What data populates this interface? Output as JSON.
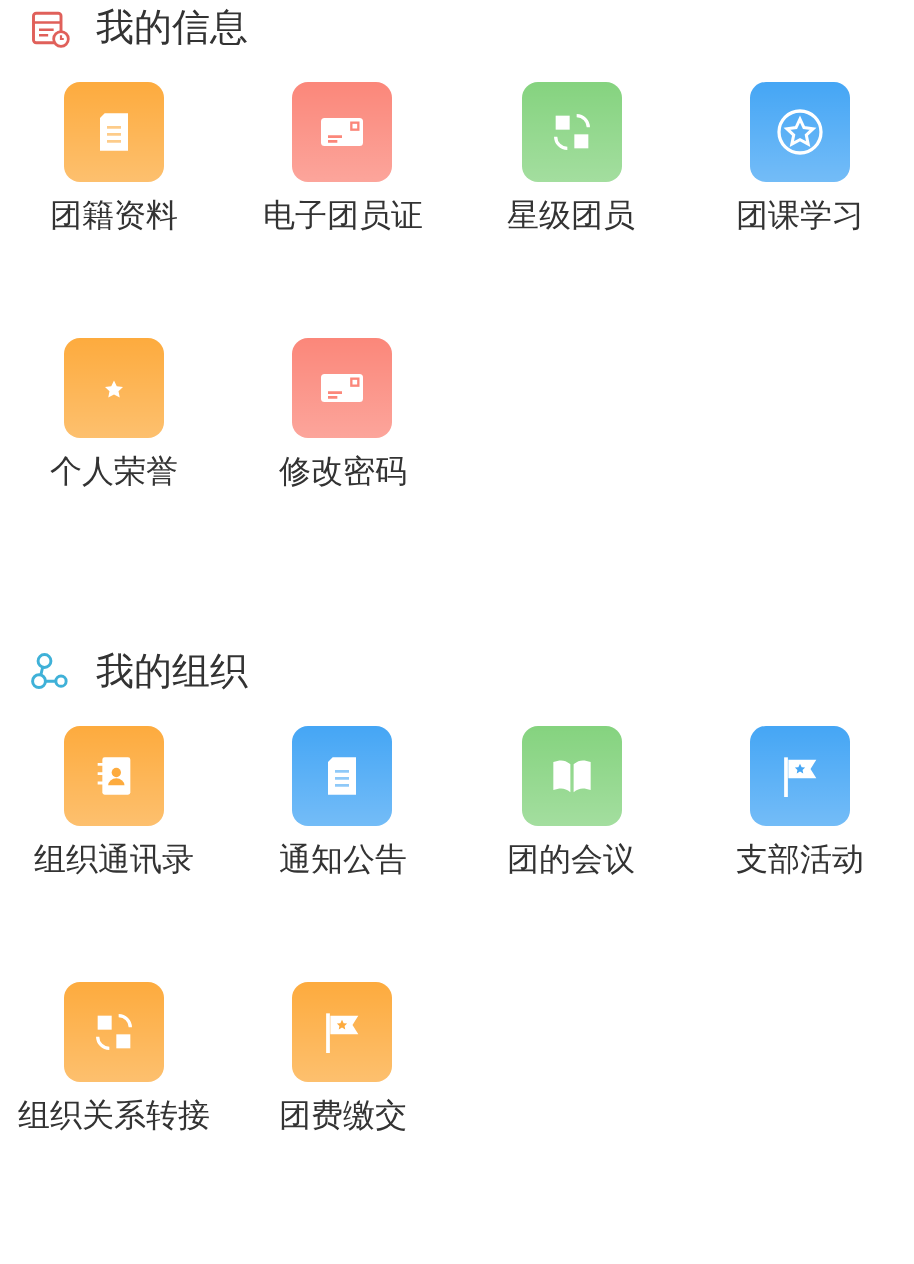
{
  "sections": [
    {
      "title": "我的信息",
      "kind": "calendar",
      "items": [
        {
          "label": "团籍资料",
          "kind": "document",
          "color": "#fdab3e"
        },
        {
          "label": "电子团员证",
          "kind": "card",
          "color": "#fb877a"
        },
        {
          "label": "星级团员",
          "kind": "swap",
          "color": "#85d37f"
        },
        {
          "label": "团课学习",
          "kind": "starcircle",
          "color": "#45a6f5"
        },
        {
          "label": "个人荣誉",
          "kind": "star",
          "color": "#fdab3e"
        },
        {
          "label": "修改密码",
          "kind": "card",
          "color": "#fb877a"
        }
      ]
    },
    {
      "title": "我的组织",
      "kind": "network",
      "items": [
        {
          "label": "组织通讯录",
          "kind": "contacts",
          "color": "#fdab3e"
        },
        {
          "label": "通知公告",
          "kind": "document",
          "color": "#45a6f5"
        },
        {
          "label": "团的会议",
          "kind": "book",
          "color": "#85d37f"
        },
        {
          "label": "支部活动",
          "kind": "flag",
          "color": "#45a6f5"
        },
        {
          "label": "组织关系转接",
          "kind": "swap",
          "color": "#fdab3e"
        },
        {
          "label": "团费缴交",
          "kind": "flag",
          "color": "#fdab3e"
        }
      ]
    }
  ]
}
